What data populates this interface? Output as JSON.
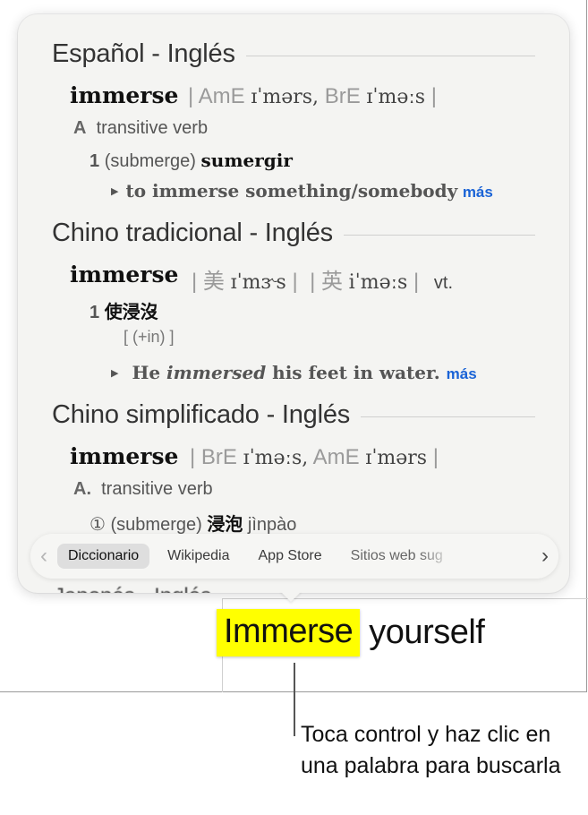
{
  "sections": [
    {
      "title": "Español - Inglés",
      "headword": "immerse",
      "pronunciation": {
        "label1": "AmE",
        "ipa1": "ɪˈmərs,",
        "label2": "BrE",
        "ipa2": "ɪˈməːs"
      },
      "pos_letter": "A",
      "pos": "transitive verb",
      "sense_num": "1",
      "sense_gloss": "(submerge)",
      "sense_trans": "sumergir",
      "example": "to immerse something/somebody",
      "more": "más"
    },
    {
      "title": "Chino tradicional - Inglés",
      "headword": "immerse",
      "pronunciation": {
        "label1": "美",
        "ipa1": "ɪˈmɝs",
        "label2": "英",
        "ipa2": "iˈməːs",
        "pos": "vt."
      },
      "sense_num": "1",
      "sense_trans": "使浸沒",
      "usage": "[ (+in) ]",
      "example_pre": "He",
      "example_em": "immersed",
      "example_post": "his feet in water.",
      "more": "más"
    },
    {
      "title": "Chino simplificado - Inglés",
      "headword": "immerse",
      "pronunciation": {
        "label1": "BrE",
        "ipa1": "ɪˈməːs,",
        "label2": "AmE",
        "ipa2": "ɪˈmərs"
      },
      "pos_letter": "A.",
      "pos": "transitive verb",
      "sense_num": "①",
      "sense_gloss": "(submerge)",
      "sense_trans": "浸泡",
      "pinyin": "jìnpào"
    }
  ],
  "partial_section_title": "Japonés - Inglés",
  "toolbar": {
    "tabs": [
      "Diccionario",
      "Wikipedia",
      "App Store",
      "Sitios web sug"
    ],
    "active": "Diccionario"
  },
  "document": {
    "highlighted_word": "Immerse",
    "rest_text": "yourself",
    "highlight_color": "#ffff00"
  },
  "caption": "Toca control y haz clic en una palabra para buscarla"
}
